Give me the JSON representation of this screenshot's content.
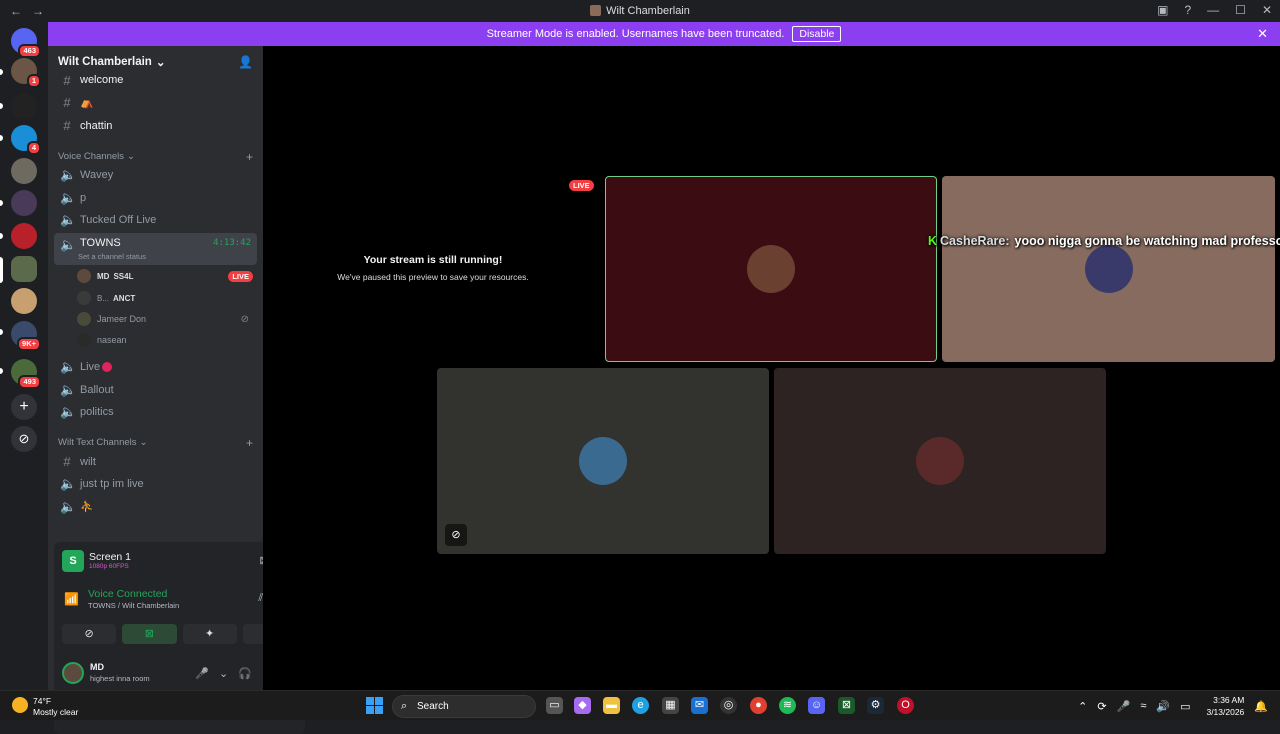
{
  "window": {
    "title": "Wilt Chamberlain"
  },
  "banner": {
    "text": "Streamer Mode is enabled. Usernames have been truncated.",
    "button": "Disable"
  },
  "guild_badges": {
    "home": "463",
    "g1": "1",
    "g3": "4",
    "g9": "9K+",
    "g10": "493"
  },
  "server": {
    "name": "Wilt Chamberlain",
    "chevron": "⌄"
  },
  "text_channels": [
    {
      "name": "welcome"
    },
    {
      "name": "⛺"
    },
    {
      "name": "chattin"
    }
  ],
  "voice_category": "Voice Channels",
  "voice_channels": {
    "wavey": "Wavey",
    "p": "p",
    "tucked": "Tucked Off Live",
    "towns": "TOWNS",
    "towns_time": "4:13:42",
    "towns_status": "Set a channel status",
    "live": "Live",
    "ballout": "Ballout",
    "politics": "politics"
  },
  "voice_users": [
    {
      "tag": "MD",
      "name": "SS4L",
      "badge": "LIVE"
    },
    {
      "tag": "B...",
      "name": "ANCT"
    },
    {
      "name": "Jameer Don"
    },
    {
      "name": "nasean"
    }
  ],
  "wilt_category": "Wilt Text Channels",
  "wilt_channels": {
    "wilt": "wilt",
    "tp": "just tp im live",
    "last": "⛹"
  },
  "screen_share": {
    "name": "Screen 1",
    "quality": "1080p 60FPS"
  },
  "voice_connected": {
    "status": "Voice Connected",
    "location": "TOWNS / Wilt Chamberlain"
  },
  "user": {
    "name": "MD",
    "status": "highest inna room"
  },
  "stage": {
    "paused_title": "Your stream is still running!",
    "paused_sub": "We've paused this preview to save your resources.",
    "live": "LIVE",
    "overlay_user": "CasheRare:",
    "overlay_msg": "yooo nigga gonna be watching mad professor"
  },
  "taskbar": {
    "temp": "74°F",
    "condition": "Mostly clear",
    "search": "Search",
    "time": "3:36 AM",
    "date": "3/13/2026"
  },
  "colors": {
    "accent": "#8c3ff0",
    "online": "#23a55a",
    "danger": "#f23f43"
  }
}
